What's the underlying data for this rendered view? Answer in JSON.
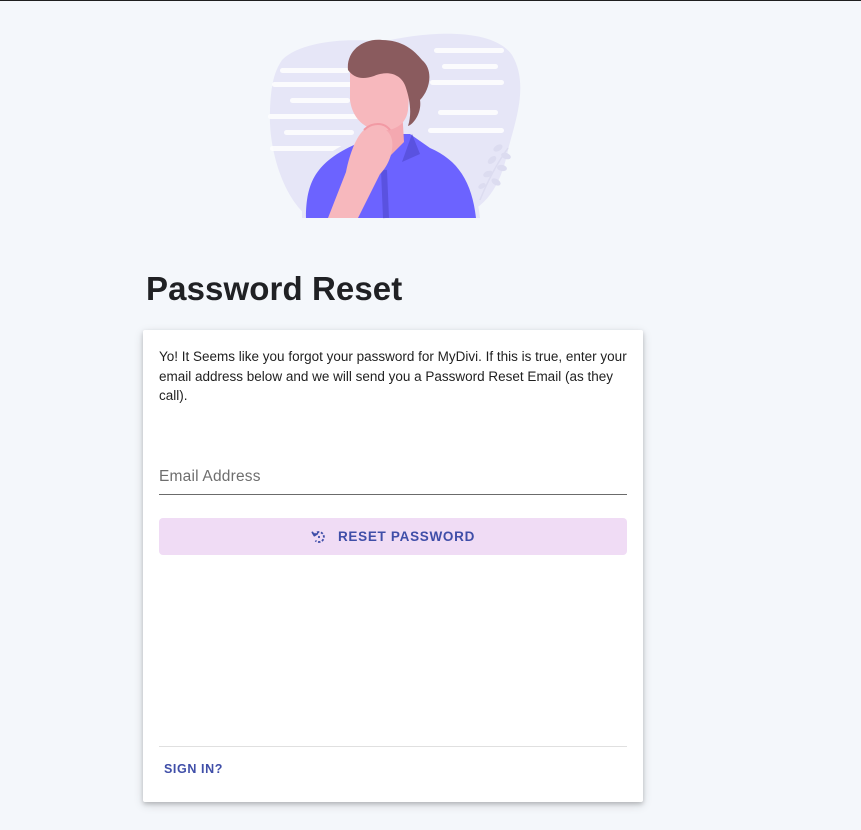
{
  "page": {
    "title": "Password Reset"
  },
  "card": {
    "intro_text": "Yo! It Seems like you forgot your password for MyDivi. If this is true, enter your email address below and we will send you a Password Reset Email (as they call).",
    "email": {
      "placeholder": "Email Address",
      "value": ""
    },
    "reset_button": {
      "label": "RESET PASSWORD",
      "icon": "reset-icon"
    },
    "sign_in_link": "SIGN IN?"
  },
  "illustration": {
    "icon": "thinking-person-illustration"
  },
  "colors": {
    "page_background": "#f4f7fb",
    "card_background": "#ffffff",
    "button_background": "#f0dcf5",
    "accent_text": "#3f4ea8",
    "shirt": "#6c63ff",
    "hair": "#8a5b5e",
    "skin": "#f7b8bd"
  }
}
